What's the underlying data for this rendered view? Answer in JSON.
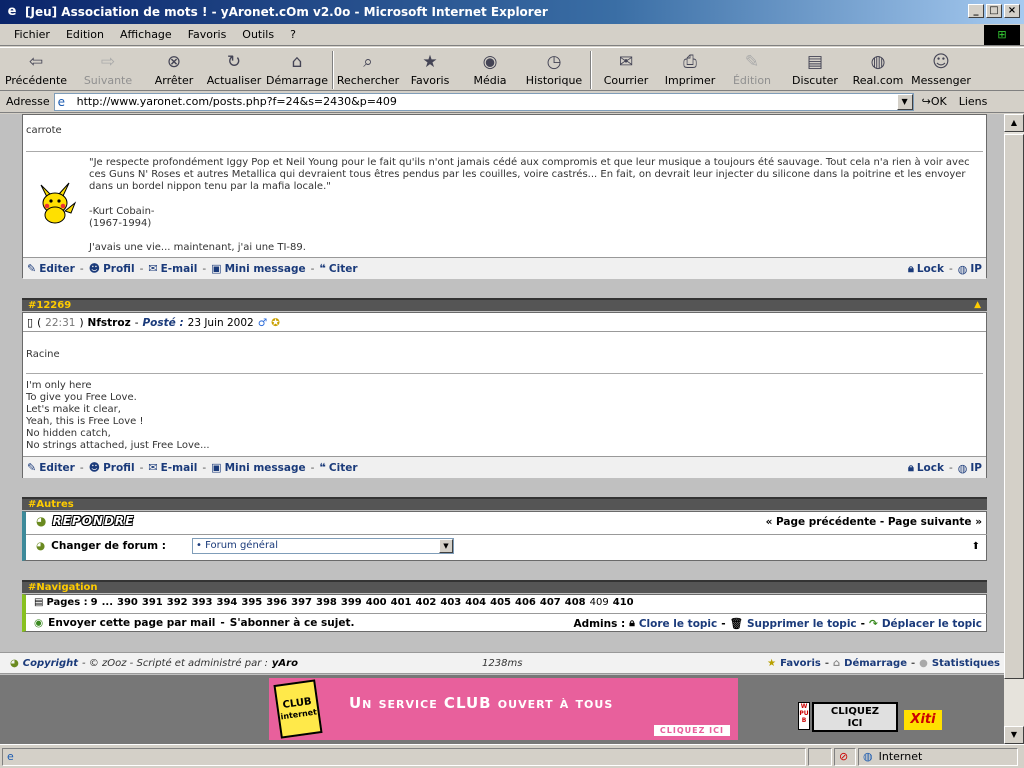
{
  "window": {
    "title": "[Jeu] Association de mots ! - yAronet.cOm v2.0o - Microsoft Internet Explorer"
  },
  "menu": [
    "Fichier",
    "Edition",
    "Affichage",
    "Favoris",
    "Outils",
    "?"
  ],
  "toolbar": [
    {
      "label": "Précédente",
      "icon": "back-arrow-icon"
    },
    {
      "label": "Suivante",
      "icon": "forward-arrow-icon"
    },
    {
      "label": "Arrêter",
      "icon": "stop-icon"
    },
    {
      "label": "Actualiser",
      "icon": "refresh-icon"
    },
    {
      "label": "Démarrage",
      "icon": "home-icon"
    },
    {
      "label": "Rechercher",
      "icon": "search-icon"
    },
    {
      "label": "Favoris",
      "icon": "favorites-icon"
    },
    {
      "label": "Média",
      "icon": "media-icon"
    },
    {
      "label": "Historique",
      "icon": "history-icon"
    },
    {
      "label": "Courrier",
      "icon": "mail-icon"
    },
    {
      "label": "Imprimer",
      "icon": "print-icon"
    },
    {
      "label": "Édition",
      "icon": "edit-icon"
    },
    {
      "label": "Discuter",
      "icon": "discuss-icon"
    },
    {
      "label": "Real.com",
      "icon": "real-icon"
    },
    {
      "label": "Messenger",
      "icon": "messenger-icon"
    }
  ],
  "address": {
    "label": "Adresse",
    "url": "http://www.yaronet.com/posts.php?f=24&s=2430&p=409",
    "go": "OK",
    "links": "Liens"
  },
  "post1": {
    "word": "carrote",
    "quote": "\"Je respecte profondément Iggy Pop et Neil Young pour le fait qu'ils n'ont jamais cédé aux compromis et que leur musique a toujours été sauvage. Tout cela n'a rien à voir avec ces Guns N' Roses et autres Metallica qui devraient tous êtres pendus par les couilles, voire castrés... En fait, on devrait leur injecter du silicone dans la poitrine et les envoyer dans un bordel nippon tenu par la mafia locale.\"",
    "author": "-Kurt Cobain-",
    "years": "(1967-1994)",
    "tagline": "J'avais une vie... maintenant, j'ai une TI-89."
  },
  "actions": {
    "edit": "Editer",
    "profile": "Profil",
    "email": "E-mail",
    "mini": "Mini message",
    "quote": "Citer",
    "lock": "Lock",
    "ip": "IP"
  },
  "post2": {
    "id": "#12269",
    "time": "22:31",
    "user": "Nfstroz",
    "posted_label": "Posté :",
    "date": "23 Juin 2002",
    "word": "Racine",
    "lines": [
      "I'm only here",
      "To give you Free Love.",
      "Let's make it clear,",
      "Yeah, this is Free Love !",
      "No hidden catch,",
      "No strings attached, just Free Love..."
    ]
  },
  "autres": {
    "title": "#Autres",
    "reply": "REPONDRE",
    "prev": "« Page précédente",
    "next": "Page suivante »",
    "change_forum": "Changer de forum :",
    "forum_selected": "• Forum général"
  },
  "navigation": {
    "title": "#Navigation",
    "pages_label": "Pages :",
    "pages": [
      "9",
      "...",
      "390",
      "391",
      "392",
      "393",
      "394",
      "395",
      "396",
      "397",
      "398",
      "399",
      "400",
      "401",
      "402",
      "403",
      "404",
      "405",
      "406",
      "407",
      "408",
      "409",
      "410"
    ],
    "current_page": "409",
    "send": "Envoyer cette page par mail",
    "subscribe": "S'abonner à ce sujet.",
    "admins": "Admins :",
    "close": "Clore le topic",
    "delete": "Supprimer le topic",
    "move": "Déplacer le topic"
  },
  "footer": {
    "copyright": "Copyright",
    "sep1": "- © zOoz - Scripté et administré par :",
    "admin": "yAro",
    "time": "1238ms",
    "fav": "Favoris",
    "home": "Démarrage",
    "stats": "Statistiques"
  },
  "banner": {
    "club1": "CLUB",
    "club2": "internet",
    "headline": "Un service CLUB ouvert à tous",
    "cta": "CLIQUEZ ICI",
    "wpub": "WPUB",
    "click": "CLIQUEZ ICI",
    "xiti": "Xiti"
  },
  "status": {
    "zone": "Internet"
  }
}
